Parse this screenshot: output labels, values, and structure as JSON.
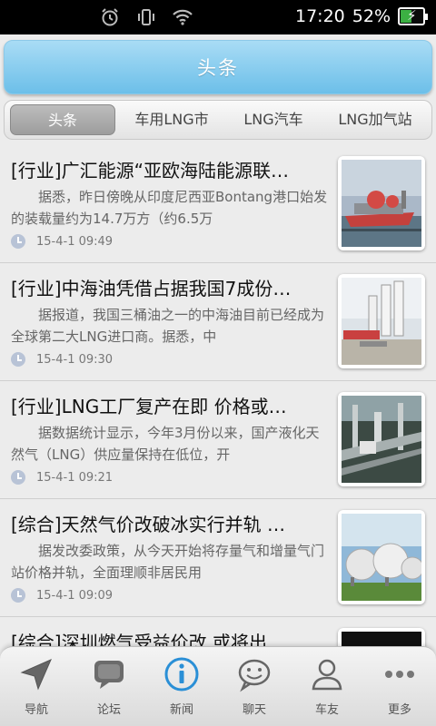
{
  "status_bar": {
    "time": "17:20",
    "battery_percent": "52%",
    "battery_level": 0.52,
    "icons": [
      "alarm-icon",
      "vibrate-icon",
      "wifi-icon",
      "battery-charging-icon"
    ]
  },
  "header": {
    "title": "头条"
  },
  "tabs": [
    {
      "label": "头条",
      "active": true
    },
    {
      "label": "车用LNG市",
      "active": false
    },
    {
      "label": "LNG汽车",
      "active": false
    },
    {
      "label": "LNG加气站",
      "active": false
    }
  ],
  "news": [
    {
      "title": "[行业]广汇能源“亚欧海陆能源联…",
      "summary": "据悉，昨日傍晚从印度尼西亚Bontang港口始发的装载量约为14.7万方（约6.5万",
      "time": "15-4-1 09:49",
      "thumb": "lng-tanker-ship"
    },
    {
      "title": "[行业]中海油凭借占据我国7成份…",
      "summary": "据报道，我国三桶油之一的中海油目前已经成为全球第二大LNG进口商。据悉，中",
      "time": "15-4-1 09:30",
      "thumb": "lng-station"
    },
    {
      "title": "[行业]LNG工厂复产在即 价格或…",
      "summary": "据数据统计显示，今年3月份以来，国产液化天然气（LNG）供应量保持在低位，开",
      "time": "15-4-1 09:21",
      "thumb": "lng-plant"
    },
    {
      "title": "[综合]天然气价改破冰实行并轨 …",
      "summary": "据发改委政策，从今天开始将存量气和增量气门站价格并轨，全面理顺非居民用",
      "time": "15-4-1 09:09",
      "thumb": "gas-spheres"
    },
    {
      "title": "[综合]深圳燃气受益价改 或将出…",
      "summary": "",
      "time": "",
      "thumb": "dark-image"
    }
  ],
  "bottom_nav": [
    {
      "label": "导航",
      "icon": "navigation-arrow-icon",
      "active": false
    },
    {
      "label": "论坛",
      "icon": "forum-bubble-icon",
      "active": false
    },
    {
      "label": "新闻",
      "icon": "info-icon",
      "active": true
    },
    {
      "label": "聊天",
      "icon": "chat-face-icon",
      "active": false
    },
    {
      "label": "车友",
      "icon": "user-icon",
      "active": false
    },
    {
      "label": "更多",
      "icon": "more-dots-icon",
      "active": false
    }
  ],
  "colors": {
    "accent": "#6cbfe9",
    "active_nav": "#2a8fd6"
  }
}
